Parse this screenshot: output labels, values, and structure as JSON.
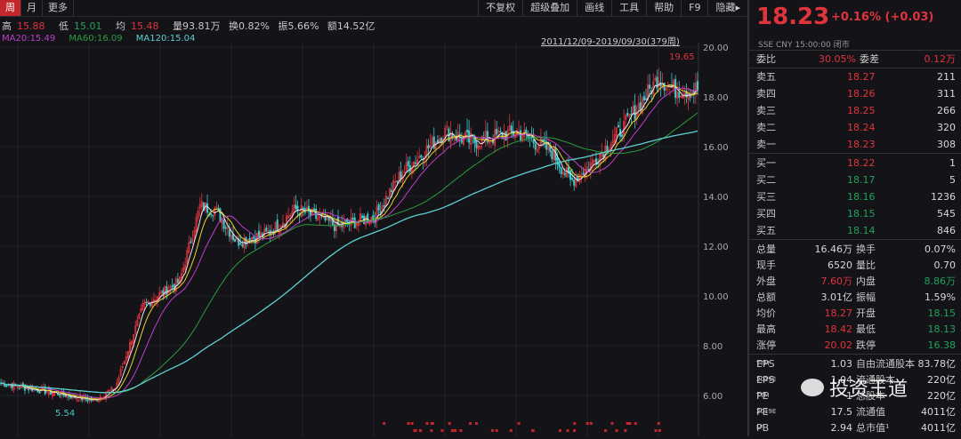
{
  "tabs": [
    "周",
    "月",
    "更多"
  ],
  "toolbar": [
    "不复权",
    "超级叠加",
    "画线",
    "工具",
    "帮助",
    "F9",
    "隐藏▸"
  ],
  "info": {
    "high_label": "高",
    "high": "15.88",
    "low_label": "低",
    "low": "15.01",
    "avg_label": "均",
    "avg": "15.48",
    "vol": "量93.81万",
    "turnover": "换0.82%",
    "amplitude": "振5.66%",
    "amount": "额14.52亿"
  },
  "ma_labels": {
    "ma20": "MA20:15.49",
    "ma60": "MA60:16.09",
    "ma120": "MA120:15.04"
  },
  "range": "2011/12/09-2019/09/30(379周)",
  "quote": {
    "price": "18.23",
    "change": "+0.16% (+0.03)",
    "exchange": "SSE  CNY  15:00:00  闭市"
  },
  "weibi": {
    "label1": "委比",
    "val1": "30.05%",
    "label2": "委差",
    "val2": "0.12万"
  },
  "asks": [
    {
      "label": "卖五",
      "price": "18.27",
      "vol": "211"
    },
    {
      "label": "卖四",
      "price": "18.26",
      "vol": "311"
    },
    {
      "label": "卖三",
      "price": "18.25",
      "vol": "266"
    },
    {
      "label": "卖二",
      "price": "18.24",
      "vol": "320"
    },
    {
      "label": "卖一",
      "price": "18.23",
      "vol": "308"
    }
  ],
  "bids": [
    {
      "label": "买一",
      "price": "18.22",
      "vol": "1",
      "color": "red"
    },
    {
      "label": "买二",
      "price": "18.17",
      "vol": "5",
      "color": "green"
    },
    {
      "label": "买三",
      "price": "18.16",
      "vol": "1236",
      "color": "green"
    },
    {
      "label": "买四",
      "price": "18.15",
      "vol": "545",
      "color": "green"
    },
    {
      "label": "买五",
      "price": "18.14",
      "vol": "846",
      "color": "green"
    }
  ],
  "stats": [
    {
      "l1": "总量",
      "v1": "16.46万",
      "c1": "wht",
      "l2": "换手",
      "v2": "0.07%",
      "c2": "wht"
    },
    {
      "l1": "现手",
      "v1": "6520",
      "c1": "wht",
      "l2": "量比",
      "v2": "0.70",
      "c2": "wht"
    },
    {
      "l1": "外盘",
      "v1": "7.60万",
      "c1": "red",
      "l2": "内盘",
      "v2": "8.86万",
      "c2": "green"
    },
    {
      "l1": "总额",
      "v1": "3.01亿",
      "c1": "wht",
      "l2": "振幅",
      "v2": "1.59%",
      "c2": "wht"
    },
    {
      "l1": "均价",
      "v1": "18.27",
      "c1": "red",
      "l2": "开盘",
      "v2": "18.15",
      "c2": "green"
    },
    {
      "l1": "最高",
      "v1": "18.42",
      "c1": "red",
      "l2": "最低",
      "v2": "18.13",
      "c2": "green"
    },
    {
      "l1": "涨停",
      "v1": "20.02",
      "c1": "red",
      "l2": "跌停",
      "v2": "16.38",
      "c2": "green"
    }
  ],
  "fundamentals": [
    {
      "l1": "EPS",
      "sup": "TTM",
      "v1": "1.03",
      "l2": "自由流通股本",
      "v2": "83.78亿"
    },
    {
      "l1": "EPS",
      "sup": "2019E",
      "v1": "1.04",
      "l2": "流通股本",
      "v2": "220亿"
    },
    {
      "l1": "PE",
      "sup": "TTM",
      "v1": "1",
      "l2": "总股本",
      "v2": "220亿"
    },
    {
      "l1": "PE",
      "sup": "2019E",
      "v1": "17.5",
      "l2": "流通值",
      "v2": "4011亿"
    },
    {
      "l1": "PB",
      "sup": "LF",
      "v1": "2.94",
      "l2": "总市值¹",
      "v2": "4011亿"
    }
  ],
  "watermark": "投资王道",
  "chart_data": {
    "type": "candlestick",
    "weeks": 379,
    "ylim": [
      4.6,
      20.3
    ],
    "yticks": [
      "20.00",
      "18.00",
      "16.00",
      "14.00",
      "12.00",
      "10.00",
      "8.00",
      "6.00"
    ],
    "max_label": "19.65",
    "min_label": "5.54",
    "close_keypoints": [
      [
        0,
        6.5
      ],
      [
        29,
        6.1
      ],
      [
        50,
        5.8
      ],
      [
        62,
        6.3
      ],
      [
        77,
        9.6
      ],
      [
        97,
        10.6
      ],
      [
        108,
        13.6
      ],
      [
        116,
        13.5
      ],
      [
        128,
        12.2
      ],
      [
        145,
        12.5
      ],
      [
        160,
        13.5
      ],
      [
        183,
        12.8
      ],
      [
        203,
        13.2
      ],
      [
        217,
        14.9
      ],
      [
        241,
        16.6
      ],
      [
        256,
        16.2
      ],
      [
        280,
        16.6
      ],
      [
        299,
        15.8
      ],
      [
        309,
        14.6
      ],
      [
        319,
        15.2
      ],
      [
        338,
        16.8
      ],
      [
        357,
        18.8
      ],
      [
        365,
        18.3
      ]
    ],
    "colors": {
      "up": "#e0343d",
      "down": "#3fc8c8",
      "ma5": "#e8e8e8",
      "ma10": "#e8d42a",
      "ma20": "#c03fc8",
      "ma60": "#2c9c3c",
      "ma120": "#5fd0d0"
    }
  }
}
